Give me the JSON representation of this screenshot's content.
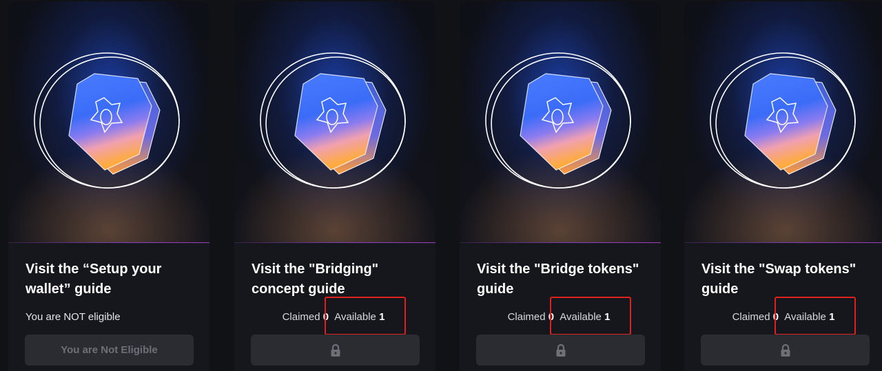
{
  "cards": [
    {
      "title": "Visit the “Setup your wallet” guide",
      "eligibility": "You are NOT eligible",
      "button_label": "You are Not Eligible"
    },
    {
      "title": "Visit the \"Bridging\" concept guide",
      "claimed_label": "Claimed",
      "claimed_value": "0",
      "available_label": "Available",
      "available_value": "1",
      "button_icon": "lock-icon"
    },
    {
      "title": "Visit the \"Bridge tokens\" guide",
      "claimed_label": "Claimed",
      "claimed_value": "0",
      "available_label": "Available",
      "available_value": "1",
      "button_icon": "lock-icon"
    },
    {
      "title": "Visit the \"Swap tokens\" guide",
      "claimed_label": "Claimed",
      "claimed_value": "0",
      "available_label": "Available",
      "available_value": "1",
      "button_icon": "lock-icon"
    }
  ],
  "colors": {
    "background": "#111216",
    "card": "#16171c",
    "highlight": "#e0201c",
    "button": "#2a2c32",
    "accent_divider": "#8a3fc4"
  }
}
